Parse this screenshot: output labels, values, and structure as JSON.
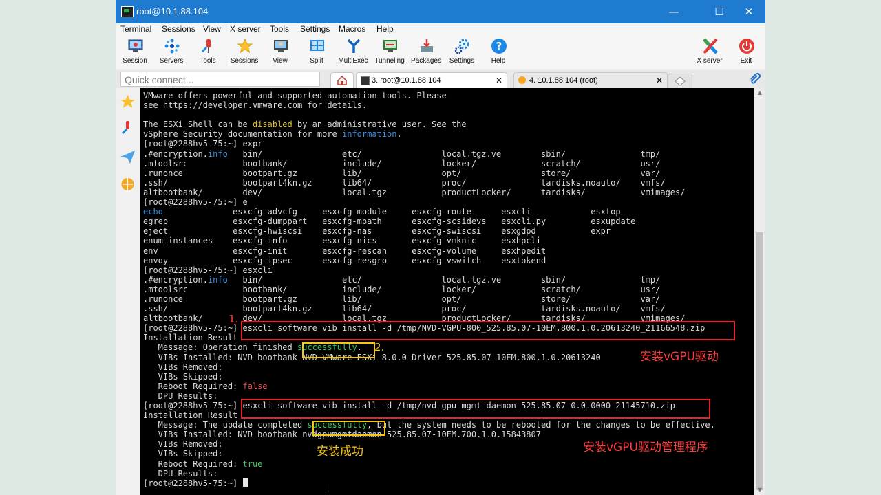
{
  "window": {
    "title": "root@10.1.88.104",
    "minimize": "—",
    "maximize": "☐",
    "close": "✕"
  },
  "menu": [
    "Terminal",
    "Sessions",
    "View",
    "X server",
    "Tools",
    "Settings",
    "Macros",
    "Help"
  ],
  "toolbar": [
    {
      "label": "Session",
      "icon": "session-icon"
    },
    {
      "label": "Servers",
      "icon": "servers-icon"
    },
    {
      "label": "Tools",
      "icon": "tools-icon"
    },
    {
      "label": "Sessions",
      "icon": "star-icon"
    },
    {
      "label": "View",
      "icon": "view-icon"
    },
    {
      "label": "Split",
      "icon": "split-icon"
    },
    {
      "label": "MultiExec",
      "icon": "multiexec-icon"
    },
    {
      "label": "Tunneling",
      "icon": "tunneling-icon"
    },
    {
      "label": "Packages",
      "icon": "packages-icon"
    },
    {
      "label": "Settings",
      "icon": "settings-gear-icon"
    },
    {
      "label": "Help",
      "icon": "help-icon"
    }
  ],
  "toolbar_right": [
    {
      "label": "X server",
      "icon": "x-server-icon"
    },
    {
      "label": "Exit",
      "icon": "power-icon"
    }
  ],
  "quick_connect": {
    "placeholder": "Quick connect..."
  },
  "tabs": [
    {
      "label": "3. root@10.1.88.104",
      "active": true,
      "close": "✕"
    },
    {
      "label": "4. 10.1.88.104 (root)",
      "active": false,
      "close": "✕"
    }
  ],
  "terminal": {
    "prompt": "[root@2288hv5-75:~]",
    "banner": [
      "VMware offers powerful and supported automation tools. Please",
      "see https://developer.vmware.com for details.",
      "",
      "The ESXi Shell can be disabled by an administrative user. See the",
      "vSphere Security documentation for more information."
    ],
    "cmd_expr": "expr",
    "cmd_e": "e",
    "cmd_esxcli": "esxcli",
    "cmd_install_1": "esxcli software vib install -d /tmp/NVD-VGPU-800_525.85.07-10EM.800.1.0.20613240_21166548.zip",
    "cmd_install_2": "esxcli software vib install -d /tmp/nvd-gpu-mgmt-daemon_525.85.07-0.0.0000_21145710.zip",
    "result_header": "Installation Result",
    "result1": {
      "message": "   Message: Operation finished successfully.",
      "vibs_installed": "   VIBs Installed: NVD_bootbank_NVD-VMware_ESXi_8.0.0_Driver_525.85.07-10EM.800.1.0.20613240",
      "vibs_removed": "   VIBs Removed:",
      "vibs_skipped": "   VIBs Skipped:",
      "reboot_label": "   Reboot Required: ",
      "reboot_value": "false",
      "dpu": "   DPU Results:"
    },
    "result2": {
      "message": "   Message: The update completed successfully, but the system needs to be rebooted for the changes to be effective.",
      "vibs_installed": "   VIBs Installed: NVD_bootbank_nvdgpumgmtdaemon_525.85.07-10EM.700.1.0.15843807",
      "vibs_removed": "   VIBs Removed:",
      "vibs_skipped": "   VIBs Skipped:",
      "reboot_label": "   Reboot Required: ",
      "reboot_value": "true",
      "dpu": "   DPU Results:"
    },
    "expr_listing": [
      [
        ".#encryption.info",
        "bin/",
        "etc/",
        "local.tgz.ve",
        "sbin/",
        "tmp/"
      ],
      [
        ".mtoolsrc",
        "bootbank/",
        "include/",
        "locker/",
        "scratch/",
        "usr/"
      ],
      [
        ".runonce",
        "bootpart.gz",
        "lib/",
        "opt/",
        "store/",
        "var/"
      ],
      [
        ".ssh/",
        "bootpart4kn.gz",
        "lib64/",
        "proc/",
        "tardisks.noauto/",
        "vmfs/"
      ],
      [
        "altbootbank/",
        "dev/",
        "local.tgz",
        "productLocker/",
        "tardisks/",
        "vmimages/"
      ]
    ],
    "e_listing": [
      [
        "echo",
        "esxcfg-advcfg",
        "esxcfg-module",
        "esxcfg-route",
        "esxcli",
        "esxtop"
      ],
      [
        "egrep",
        "esxcfg-dumppart",
        "esxcfg-mpath",
        "esxcfg-scsidevs",
        "esxcli.py",
        "esxupdate"
      ],
      [
        "eject",
        "esxcfg-hwiscsi",
        "esxcfg-nas",
        "esxcfg-swiscsi",
        "esxgdpd",
        "expr"
      ],
      [
        "enum_instances",
        "esxcfg-info",
        "esxcfg-nics",
        "esxcfg-vmknic",
        "esxhpcli",
        ""
      ],
      [
        "env",
        "esxcfg-init",
        "esxcfg-rescan",
        "esxcfg-volume",
        "esxhpedit",
        ""
      ],
      [
        "envoy",
        "esxcfg-ipsec",
        "esxcfg-resgrp",
        "esxcfg-vswitch",
        "esxtokend",
        ""
      ]
    ]
  },
  "annotations": {
    "n1": "1.",
    "n2": "2.",
    "install_driver": "安装vGPU驱动",
    "install_manager": "安装vGPU驱动管理程序",
    "install_success": "安装成功"
  },
  "colors": {
    "titlebar": "#1e7bd0",
    "terminal_bg": "#000000",
    "highlight_red": "#e5242a",
    "highlight_yellow": "#f5c518",
    "term_cyan": "#3a8fe0",
    "term_yellow": "#e5c22c",
    "term_red": "#ee4a4a",
    "term_green": "#3cc85a"
  }
}
